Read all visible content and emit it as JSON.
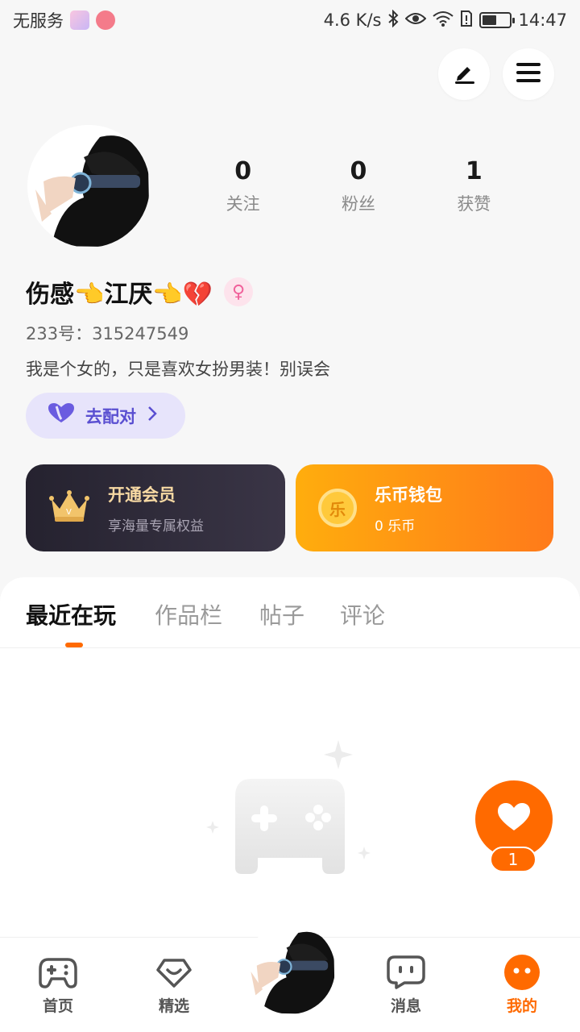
{
  "status_bar": {
    "carrier": "无服务",
    "speed": "4.6 K/s",
    "time": "14:47",
    "battery_level": 0.45
  },
  "profile": {
    "stats": [
      {
        "value": "0",
        "label": "关注"
      },
      {
        "value": "0",
        "label": "粉丝"
      },
      {
        "value": "1",
        "label": "获赞"
      }
    ],
    "username": "伤感👈江厌👈💔",
    "gender_icon": "female-icon",
    "uid": "233号：315247549",
    "bio": "我是个女的，只是喜欢女扮男装！别误会",
    "match_button": "去配对"
  },
  "cards": {
    "vip": {
      "title": "开通会员",
      "subtitle": "享海量专属权益"
    },
    "wallet": {
      "title": "乐币钱包",
      "subtitle": "0 乐币",
      "coin_glyph": "乐"
    }
  },
  "tabs": [
    "最近在玩",
    "作品栏",
    "帖子",
    "评论"
  ],
  "like": {
    "count": "1"
  },
  "nav": {
    "items": [
      "首页",
      "精选",
      "消息",
      "我的"
    ]
  },
  "colors": {
    "accent": "#ff6a00",
    "match_bg": "#e7e4fb",
    "match_text": "#5a4fd1"
  }
}
